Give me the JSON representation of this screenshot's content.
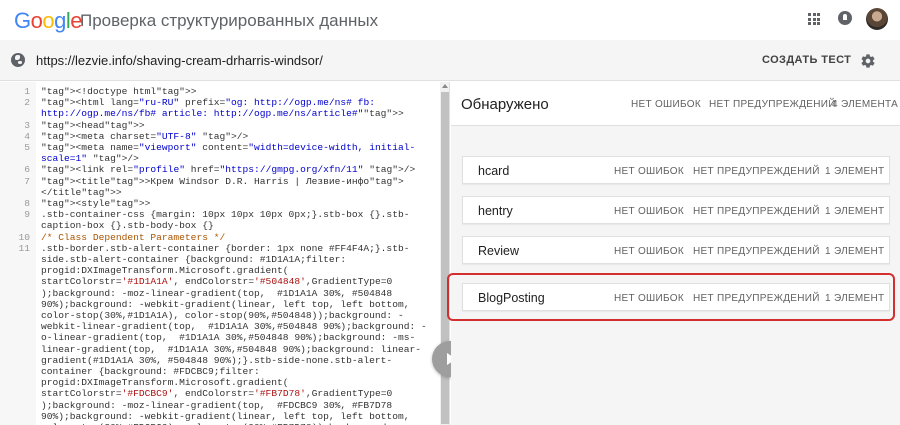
{
  "header": {
    "logo": [
      {
        "ch": "G",
        "color": "#4285F4"
      },
      {
        "ch": "o",
        "color": "#EA4335"
      },
      {
        "ch": "o",
        "color": "#FBBC05"
      },
      {
        "ch": "g",
        "color": "#4285F4"
      },
      {
        "ch": "l",
        "color": "#34A853"
      },
      {
        "ch": "e",
        "color": "#EA4335"
      }
    ],
    "title": "Проверка структурированных данных",
    "icons": [
      "apps-grid-icon",
      "notifications-icon",
      "user-avatar"
    ]
  },
  "urlbar": {
    "icon": "globe-icon",
    "url": "https://lezvie.info/shaving-cream-drharris-windsor/",
    "create_test_label": "СОЗДАТЬ ТЕСТ",
    "settings_icon": "gear-icon"
  },
  "code": {
    "lines": [
      {
        "n": "1",
        "text": "<!doctype html>"
      },
      {
        "n": "2",
        "text": "<html lang=\"ru-RU\" prefix=\"og: http://ogp.me/ns# fb: http://ogp.me/ns/fb# article: http://ogp.me/ns/article#\">"
      },
      {
        "n": "3",
        "text": "<head>"
      },
      {
        "n": "4",
        "text": "<meta charset=\"UTF-8\" />"
      },
      {
        "n": "5",
        "text": "<meta name=\"viewport\" content=\"width=device-width, initial-scale=1\" />"
      },
      {
        "n": "6",
        "text": "<link rel=\"profile\" href=\"https://gmpg.org/xfn/11\" />"
      },
      {
        "n": "7",
        "text": "<title>Крем Windsor D.R. Harris | Лезвие-инфо</title>"
      },
      {
        "n": "8",
        "text": "<style>"
      },
      {
        "n": "9",
        "text": ".stb-container-css {margin: 10px 10px 10px 0px;}.stb-box {}.stb-caption-box {}.stb-body-box {}"
      },
      {
        "n": "10",
        "text": "/* Class Dependent Parameters */"
      },
      {
        "n": "11",
        "text": ".stb-border.stb-alert-container {border: 1px none #FF4F4A;}.stb-side.stb-alert-container {background: #1D1A1A;filter: progid:DXImageTransform.Microsoft.gradient( startColorstr='#1D1A1A', endColorstr='#504848',GradientType=0 );background: -moz-linear-gradient(top,  #1D1A1A 30%, #504848 90%);background: -webkit-gradient(linear, left top, left bottom, color-stop(30%,#1D1A1A), color-stop(90%,#504848));background: -webkit-linear-gradient(top,  #1D1A1A 30%,#504848 90%);background: -o-linear-gradient(top,  #1D1A1A 30%,#504848 90%);background: -ms-linear-gradient(top,  #1D1A1A 30%,#504848 90%);background: linear-gradient(#1D1A1A 30%, #504848 90%);}.stb-side-none.stb-alert-container {background: #FDCBC9;filter: progid:DXImageTransform.Microsoft.gradient( startColorstr='#FDCBC9', endColorstr='#FB7D78',GradientType=0 );background: -moz-linear-gradient(top,  #FDCBC9 30%, #FB7D78 90%);background: -webkit-gradient(linear, left top, left bottom, color-stop(30%,#FDCBC9), color-stop(90%,#FB7D78));background: -webkit-linear-gradient(top,  #FDCBC9"
      }
    ]
  },
  "results": {
    "title": "Обнаружено",
    "no_errors": "НЕТ ОШИБОК",
    "no_warnings": "НЕТ ПРЕДУПРЕЖДЕНИЙ",
    "count": "4 ЭЛЕМЕНТА",
    "items": [
      {
        "name": "hcard",
        "errors": "НЕТ ОШИБОК",
        "warnings": "НЕТ ПРЕДУПРЕЖДЕНИЙ",
        "count": "1 ЭЛЕМЕНТ"
      },
      {
        "name": "hentry",
        "errors": "НЕТ ОШИБОК",
        "warnings": "НЕТ ПРЕДУПРЕЖДЕНИЙ",
        "count": "1 ЭЛЕМЕНТ"
      },
      {
        "name": "Review",
        "errors": "НЕТ ОШИБОК",
        "warnings": "НЕТ ПРЕДУПРЕЖДЕНИЙ",
        "count": "1 ЭЛЕМЕНТ"
      },
      {
        "name": "BlogPosting",
        "errors": "НЕТ ОШИБОК",
        "warnings": "НЕТ ПРЕДУПРЕЖДЕНИЙ",
        "count": "1 ЭЛЕМЕНТ"
      }
    ],
    "highlight_color": "#d32f2f"
  }
}
